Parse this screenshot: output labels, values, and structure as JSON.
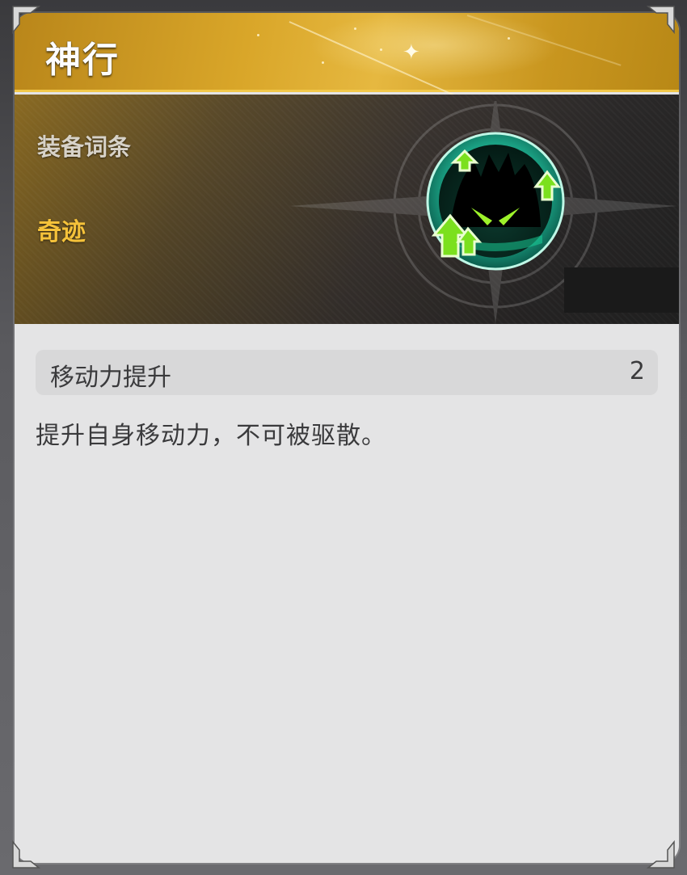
{
  "card": {
    "title": "神行",
    "section_label": "装备词条",
    "rarity": "奇迹"
  },
  "stat": {
    "name": "移动力提升",
    "value": "2"
  },
  "description": "提升自身移动力，不可被驱散。",
  "colors": {
    "banner_gold": "#d9a629",
    "rarity_gold": "#f5c23a",
    "emblem_teal": "#1fb28c",
    "arrow_green": "#7be01e",
    "body_bg": "#e4e4e5"
  },
  "icons": {
    "emblem": "speed-up-emblem-icon",
    "corner": "corner-ornament-icon"
  }
}
